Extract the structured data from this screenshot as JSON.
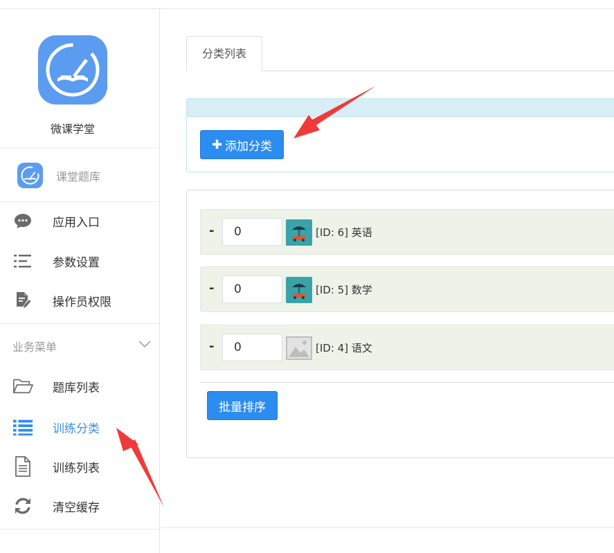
{
  "brand": {
    "name": "微课学堂"
  },
  "module": {
    "label": "课堂题库"
  },
  "nav_top": [
    {
      "label": "应用入口",
      "icon": "chat-icon"
    },
    {
      "label": "参数设置",
      "icon": "settings-list-icon"
    },
    {
      "label": "操作员权限",
      "icon": "document-edit-icon"
    }
  ],
  "section": {
    "title": "业务菜单"
  },
  "nav_business": [
    {
      "label": "题库列表",
      "icon": "folder-open-icon",
      "active": false
    },
    {
      "label": "训练分类",
      "icon": "list-icon",
      "active": true
    },
    {
      "label": "训练列表",
      "icon": "file-text-icon",
      "active": false
    },
    {
      "label": "清空缓存",
      "icon": "refresh-icon",
      "active": false
    }
  ],
  "main": {
    "tab_label": "分类列表",
    "add_button": "添加分类",
    "sort_button": "批量排序",
    "rows": [
      {
        "dash": "-",
        "sort_value": "0",
        "label": "[ID: 6] 英语",
        "thumb": "image"
      },
      {
        "dash": "-",
        "sort_value": "0",
        "label": "[ID: 5] 数学",
        "thumb": "image"
      },
      {
        "dash": "-",
        "sort_value": "0",
        "label": "[ID: 4] 语文",
        "thumb": "placeholder"
      }
    ]
  },
  "colors": {
    "accent": "#2d8cf0",
    "active_nav": "#3a8ee6",
    "logo": "#5b9cf0",
    "annotation": "#f03a3a"
  }
}
